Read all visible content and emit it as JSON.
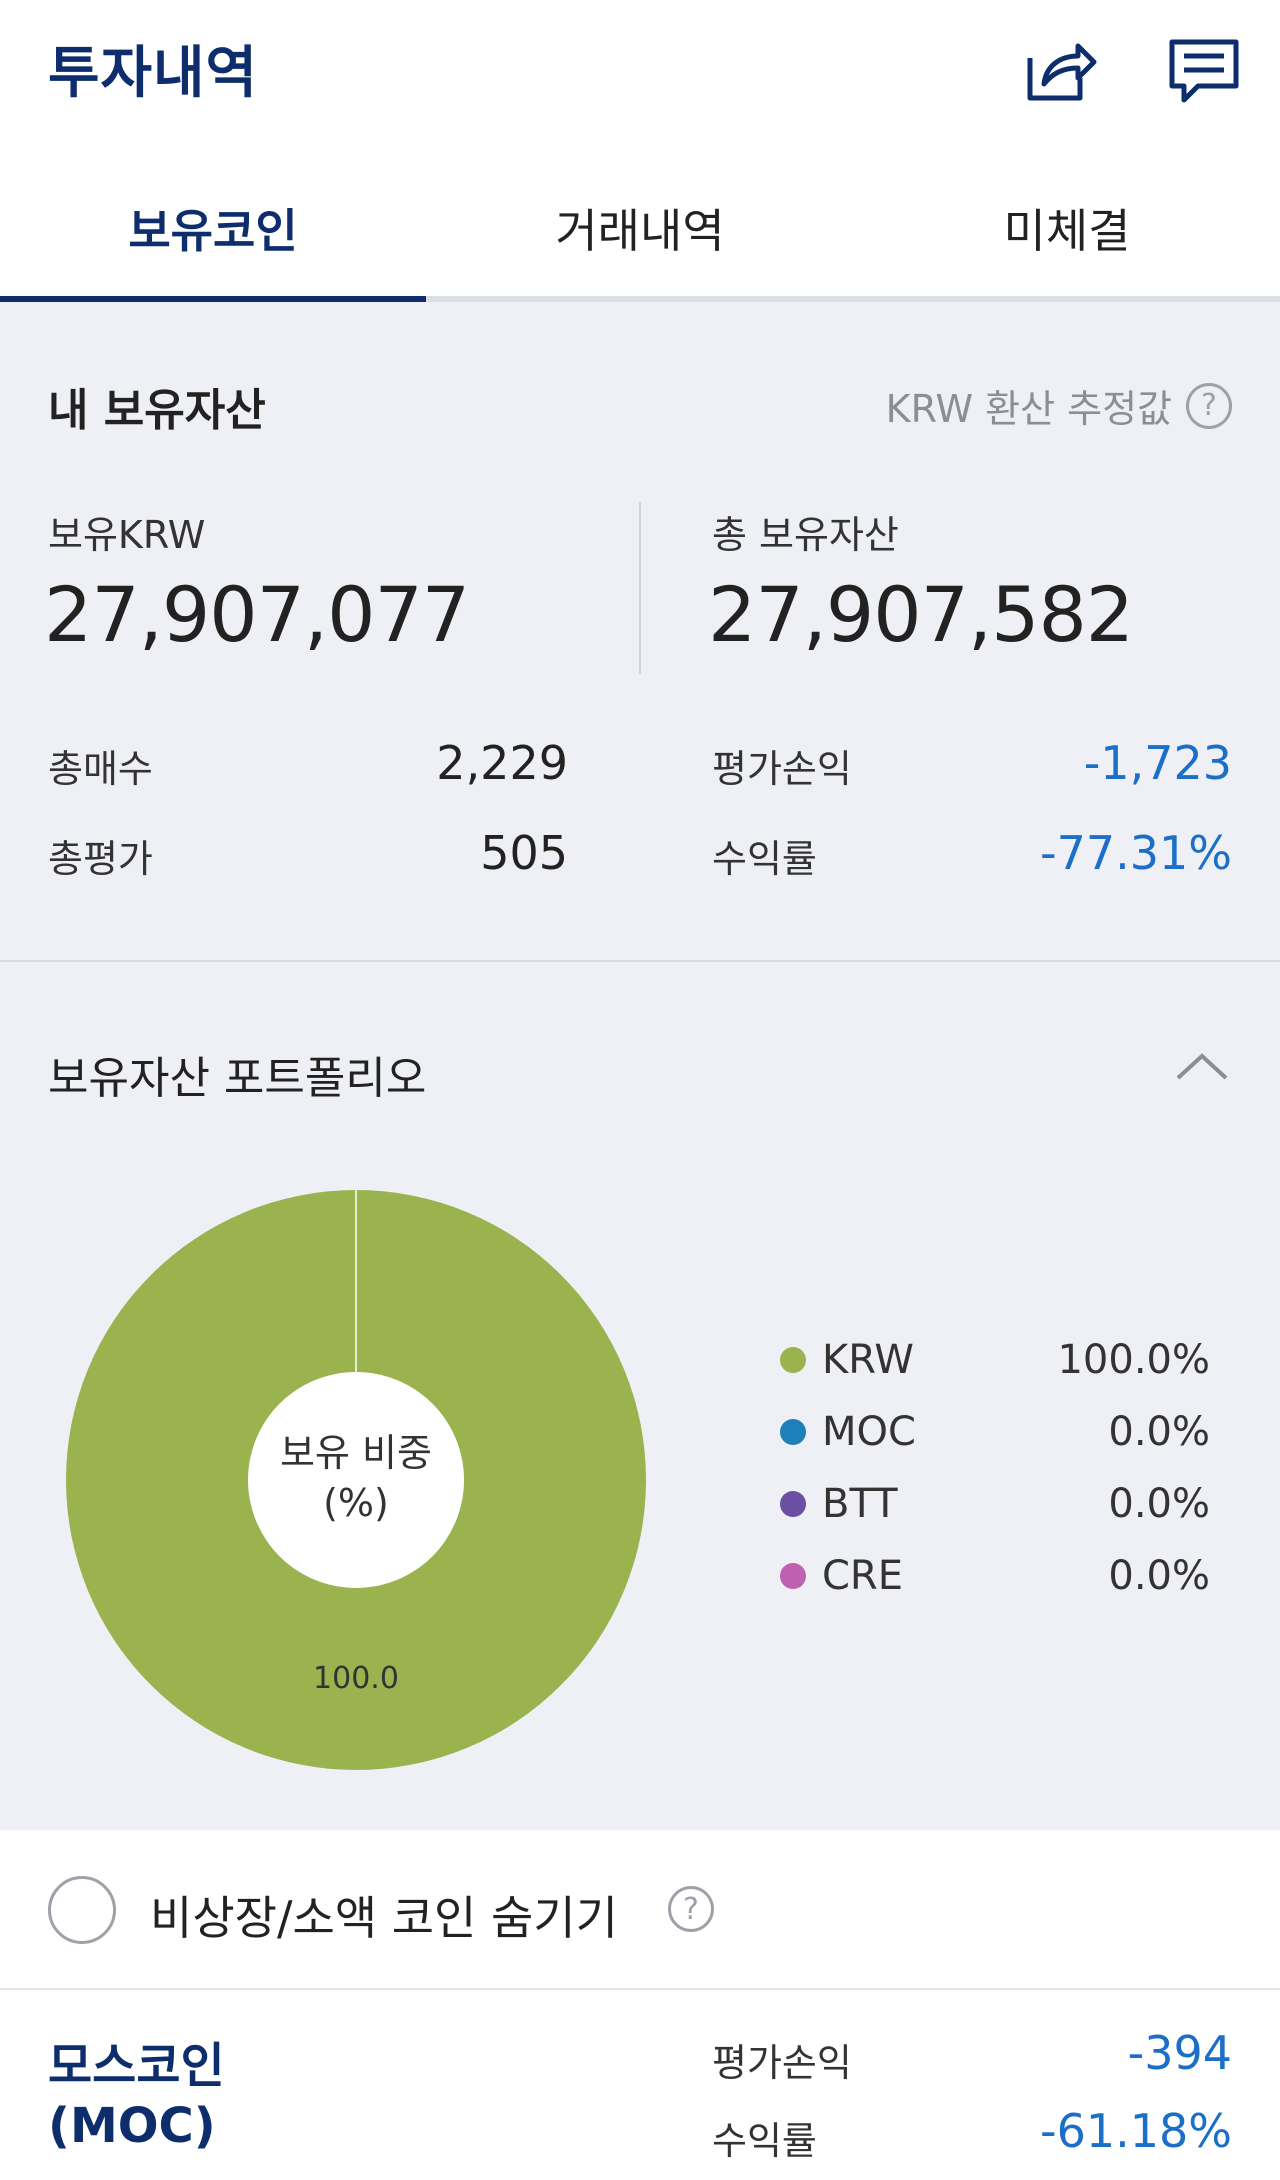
{
  "header": {
    "title": "투자내역",
    "icons": [
      "share-icon",
      "chat-icon"
    ]
  },
  "tabs": [
    {
      "label": "보유코인",
      "active": true
    },
    {
      "label": "거래내역",
      "active": false
    },
    {
      "label": "미체결",
      "active": false
    }
  ],
  "assets": {
    "title": "내 보유자산",
    "krw_note": "KRW 환산 추정값",
    "krw_label": "보유KRW",
    "krw_value": "27,907,077",
    "total_label": "총 보유자산",
    "total_value": "27,907,582",
    "buy_label": "총매수",
    "buy_value": "2,229",
    "eval_label": "총평가",
    "eval_value": "505",
    "pnl_label": "평가손익",
    "pnl_value": "-1,723",
    "rate_label": "수익률",
    "rate_value": "-77.31%"
  },
  "portfolio": {
    "title": "보유자산 포트폴리오",
    "center_line1": "보유 비중",
    "center_line2": "(%)",
    "slice_label": "100.0"
  },
  "chart_data": {
    "type": "pie",
    "categories": [
      "KRW",
      "MOC",
      "BTT",
      "CRE"
    ],
    "values": [
      100.0,
      0.0,
      0.0,
      0.0
    ],
    "labels": [
      "100.0%",
      "0.0%",
      "0.0%",
      "0.0%"
    ],
    "colors": [
      "#9bb34f",
      "#1f7fb8",
      "#6b4fa3",
      "#c060b0"
    ],
    "legend": "right"
  },
  "filter": {
    "label": "비상장/소액 코인 숨기기"
  },
  "coin": {
    "name": "모스코인",
    "symbol": "(MOC)",
    "pnl_label": "평가손익",
    "pnl_value": "-394",
    "rate_label": "수익률",
    "rate_value": "-61.18%"
  },
  "colors": {
    "brand": "#0d2d6c",
    "negative": "#1c6fc9",
    "background": "#eef0f5"
  }
}
